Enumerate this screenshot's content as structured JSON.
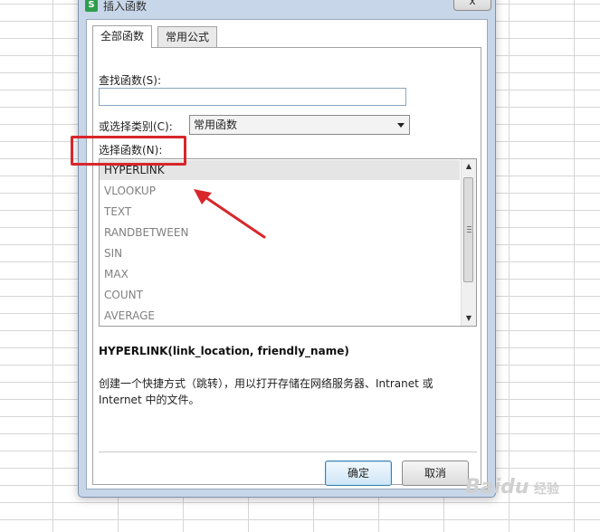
{
  "dialog": {
    "title": "插入函数",
    "app_icon": "S",
    "close_label": "x"
  },
  "tabs": [
    {
      "label": "全部函数",
      "active": true
    },
    {
      "label": "常用公式",
      "active": false
    }
  ],
  "search": {
    "label": "查找函数(S):",
    "value": "",
    "placeholder": ""
  },
  "category": {
    "label": "或选择类别(C):",
    "selected": "常用函数"
  },
  "function_list": {
    "label": "选择函数(N):",
    "items": [
      "HYPERLINK",
      "VLOOKUP",
      "TEXT",
      "RANDBETWEEN",
      "SIN",
      "MAX",
      "COUNT",
      "AVERAGE"
    ],
    "selected": "HYPERLINK"
  },
  "signature": "HYPERLINK(link_location, friendly_name)",
  "description": {
    "line1": "创建一个快捷方式（跳转），用以打开存储在网络服务器、Intranet 或",
    "line2": "Internet 中的文件。"
  },
  "buttons": {
    "ok": "确定",
    "cancel": "取消"
  },
  "annotation": {
    "color": "#d8262b"
  },
  "watermark": {
    "logo_text": "Baidu",
    "sub_text": "经验"
  }
}
